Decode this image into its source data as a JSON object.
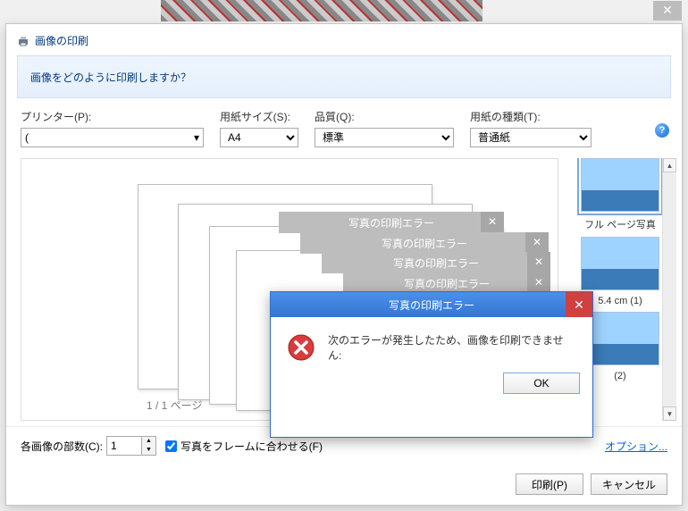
{
  "window": {
    "title": "画像の印刷"
  },
  "banner": {
    "text": "画像をどのように印刷しますか？"
  },
  "labels": {
    "printer": "プリンター(P):",
    "size": "用紙サイズ(S):",
    "quality": "品質(Q):",
    "paper": "用紙の種類(T):",
    "copies": "各画像の部数(C):",
    "fit": "写真をフレームに合わせる(F)",
    "options": "オプション...",
    "print": "印刷(P)",
    "cancel": "キャンセル",
    "page": "1 / 1 ページ"
  },
  "values": {
    "printer": "(",
    "size": "A4",
    "quality": "標準",
    "paper": "普通紙",
    "copies": "1"
  },
  "layouts": {
    "full": "フル ページ写真",
    "l1_suffix": "5.4 cm (1)",
    "l2_suffix": "(2)"
  },
  "error": {
    "title": "写真の印刷エラー",
    "message": "次のエラーが発生したため、画像を印刷できません:",
    "ok": "OK"
  }
}
